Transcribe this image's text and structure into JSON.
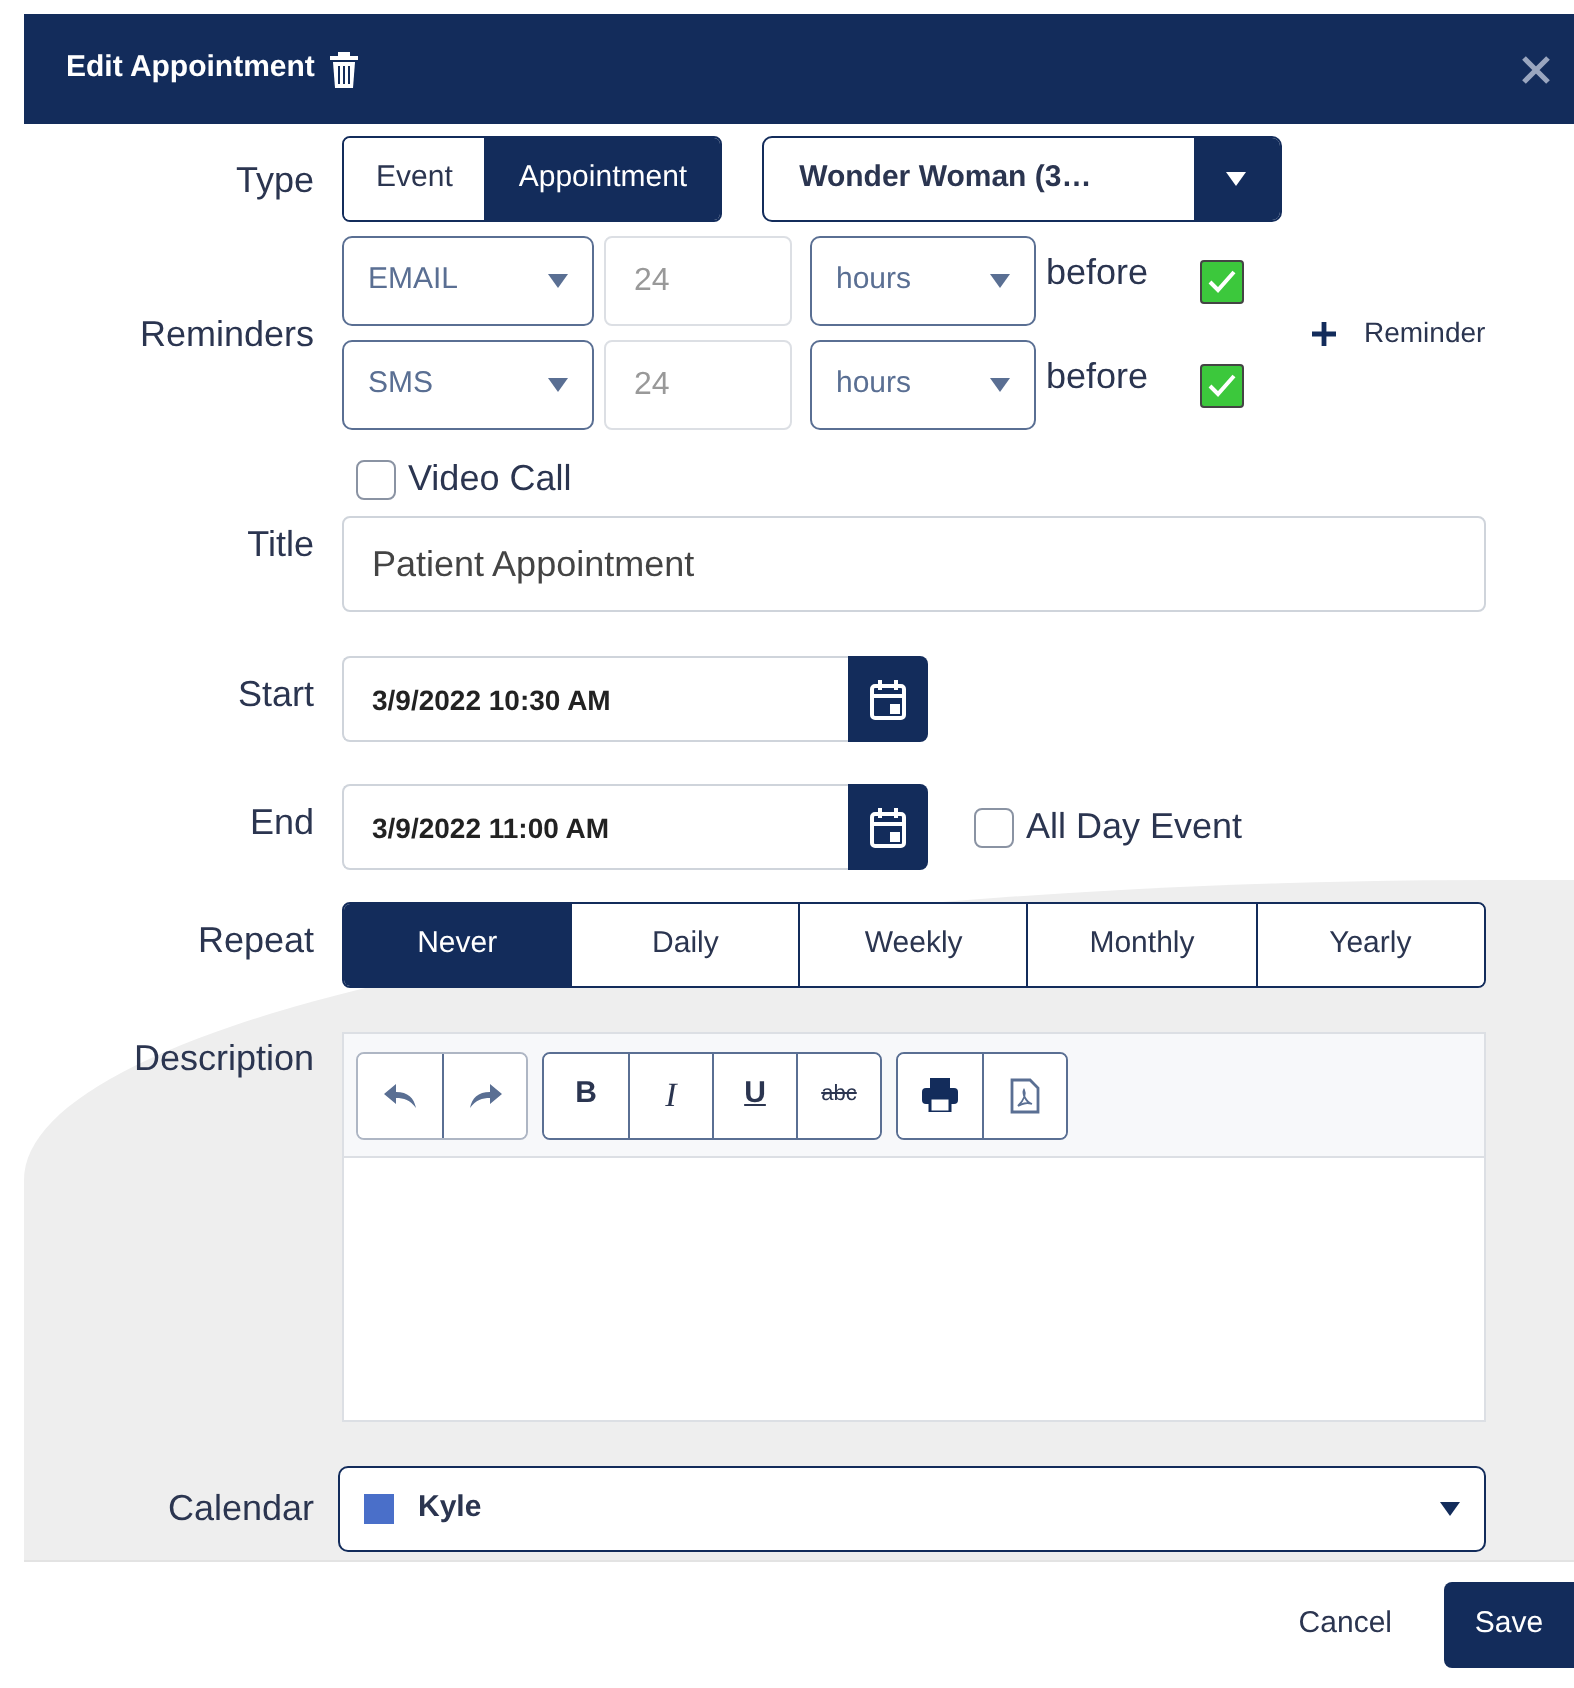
{
  "dialog": {
    "title": "Edit Appointment"
  },
  "type": {
    "label": "Type",
    "options": [
      {
        "label": "Event",
        "selected": false
      },
      {
        "label": "Appointment",
        "selected": true
      }
    ],
    "person": "Wonder Woman (3…"
  },
  "reminders": {
    "label": "Reminders",
    "items": [
      {
        "method": "EMAIL",
        "amount": "24",
        "unit": "hours",
        "suffix": "before",
        "checked": true
      },
      {
        "method": "SMS",
        "amount": "24",
        "unit": "hours",
        "suffix": "before",
        "checked": true
      }
    ],
    "add_button": "Reminder"
  },
  "video_call": {
    "label": "Video Call",
    "checked": false
  },
  "title": {
    "label": "Title",
    "value": "Patient Appointment"
  },
  "start": {
    "label": "Start",
    "value": "3/9/2022 10:30 AM"
  },
  "end": {
    "label": "End",
    "value": "3/9/2022 11:00 AM"
  },
  "all_day": {
    "label": "All Day Event",
    "checked": false
  },
  "repeat": {
    "label": "Repeat",
    "options": [
      {
        "label": "Never",
        "selected": true
      },
      {
        "label": "Daily",
        "selected": false
      },
      {
        "label": "Weekly",
        "selected": false
      },
      {
        "label": "Monthly",
        "selected": false
      },
      {
        "label": "Yearly",
        "selected": false
      }
    ]
  },
  "description": {
    "label": "Description",
    "format_buttons": [
      {
        "kind": "bold",
        "label": "B"
      },
      {
        "kind": "italic",
        "label": "I"
      },
      {
        "kind": "underline",
        "label": "U"
      },
      {
        "kind": "strike",
        "label": "abc"
      }
    ]
  },
  "calendar": {
    "label": "Calendar",
    "value": "Kyle"
  },
  "footer": {
    "cancel": "Cancel",
    "save": "Save"
  }
}
